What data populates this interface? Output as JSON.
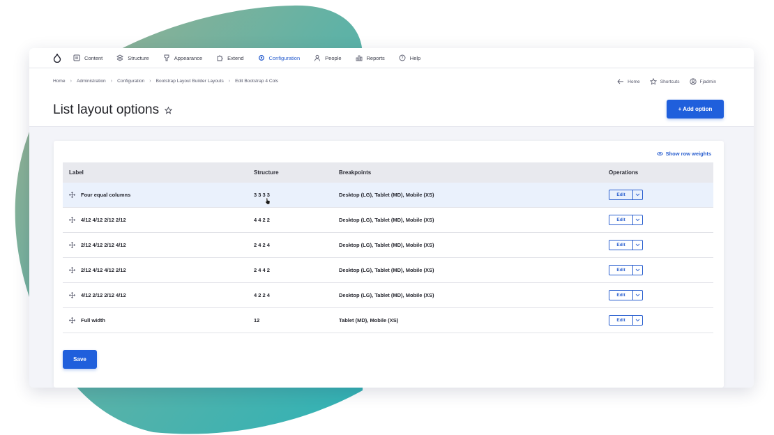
{
  "toolbar": {
    "items": [
      {
        "label": "Content",
        "icon": "content-icon"
      },
      {
        "label": "Structure",
        "icon": "structure-icon"
      },
      {
        "label": "Appearance",
        "icon": "appearance-icon"
      },
      {
        "label": "Extend",
        "icon": "extend-icon"
      },
      {
        "label": "Configuration",
        "icon": "configuration-icon",
        "active": true
      },
      {
        "label": "People",
        "icon": "people-icon"
      },
      {
        "label": "Reports",
        "icon": "reports-icon"
      },
      {
        "label": "Help",
        "icon": "help-icon"
      }
    ]
  },
  "breadcrumb": [
    "Home",
    "Administration",
    "Configuration",
    "Bootstrap Layout Builder Layouts",
    "Edit Bootstrap 4 Cols"
  ],
  "right_links": {
    "home": "Home",
    "shortcuts": "Shortcuts",
    "user": "Fjadmin"
  },
  "page": {
    "title": "List layout options",
    "add_button": "+ Add option"
  },
  "show_row_weights": "Show row weights",
  "table": {
    "headers": {
      "label": "Label",
      "structure": "Structure",
      "breakpoints": "Breakpoints",
      "operations": "Operations"
    },
    "rows": [
      {
        "label": "Four equal columns",
        "structure": "3 3 3 3",
        "breakpoints": "Desktop (LG), Tablet (MD), Mobile (XS)",
        "edit": "Edit"
      },
      {
        "label": "4/12 4/12 2/12 2/12",
        "structure": "4 4 2 2",
        "breakpoints": "Desktop (LG), Tablet (MD), Mobile (XS)",
        "edit": "Edit"
      },
      {
        "label": "2/12 4/12 2/12 4/12",
        "structure": "2 4 2 4",
        "breakpoints": "Desktop (LG), Tablet (MD), Mobile (XS)",
        "edit": "Edit"
      },
      {
        "label": "2/12 4/12 4/12 2/12",
        "structure": "2 4 4 2",
        "breakpoints": "Desktop (LG), Tablet (MD), Mobile (XS)",
        "edit": "Edit"
      },
      {
        "label": "4/12 2/12 2/12 4/12",
        "structure": "4 2 2 4",
        "breakpoints": "Desktop (LG), Tablet (MD), Mobile (XS)",
        "edit": "Edit"
      },
      {
        "label": "Full width",
        "structure": "12",
        "breakpoints": "Tablet (MD), Mobile (XS)",
        "edit": "Edit"
      }
    ]
  },
  "save_label": "Save",
  "colors": {
    "accent": "#1f5fdc",
    "link": "#2a5fcf",
    "blob_start": "#9ab08f",
    "blob_end": "#2fb2b6"
  }
}
